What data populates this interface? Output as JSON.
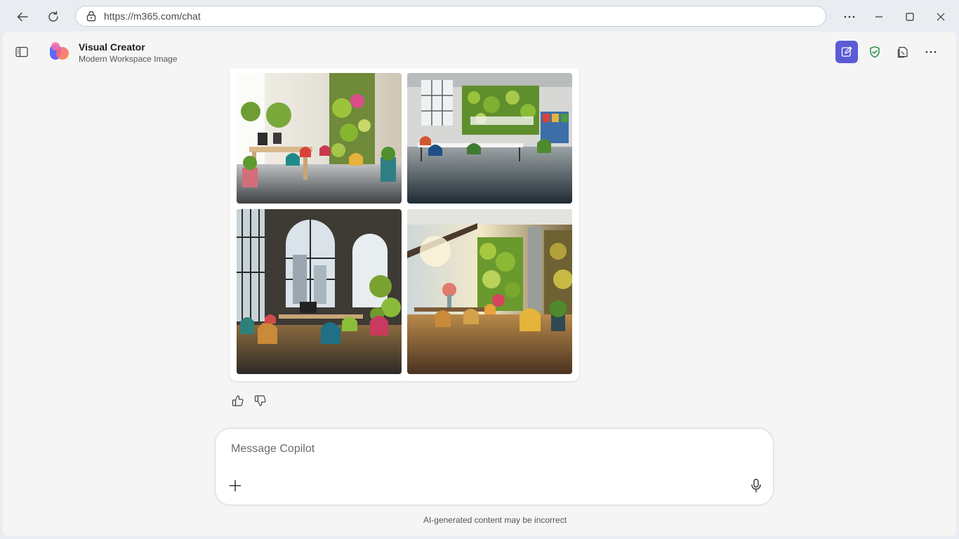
{
  "browser": {
    "url": "https://m365.com/chat",
    "icons": {
      "back": "back-arrow-icon",
      "refresh": "refresh-icon",
      "lock": "lock-icon",
      "more": "more-horizontal-icon",
      "minimize": "minimize-icon",
      "maximize": "maximize-icon",
      "close": "close-icon"
    }
  },
  "header": {
    "title": "Visual Creator",
    "subtitle": "Modern Workspace Image",
    "icons": [
      "sidebar-toggle-icon",
      "new-chat-icon",
      "shield-check-icon",
      "notebook-icon",
      "more-horizontal-icon"
    ],
    "accent_color": "#5b5bd6"
  },
  "images": [
    {
      "name": "workspace-image-1"
    },
    {
      "name": "workspace-image-2"
    },
    {
      "name": "workspace-image-3"
    },
    {
      "name": "workspace-image-4"
    }
  ],
  "feedback": {
    "icons": [
      "thumbs-up-icon",
      "thumbs-down-icon"
    ]
  },
  "composer": {
    "placeholder": "Message Copilot",
    "value": ""
  },
  "footer": {
    "disclaimer": "AI-generated content may be incorrect"
  }
}
